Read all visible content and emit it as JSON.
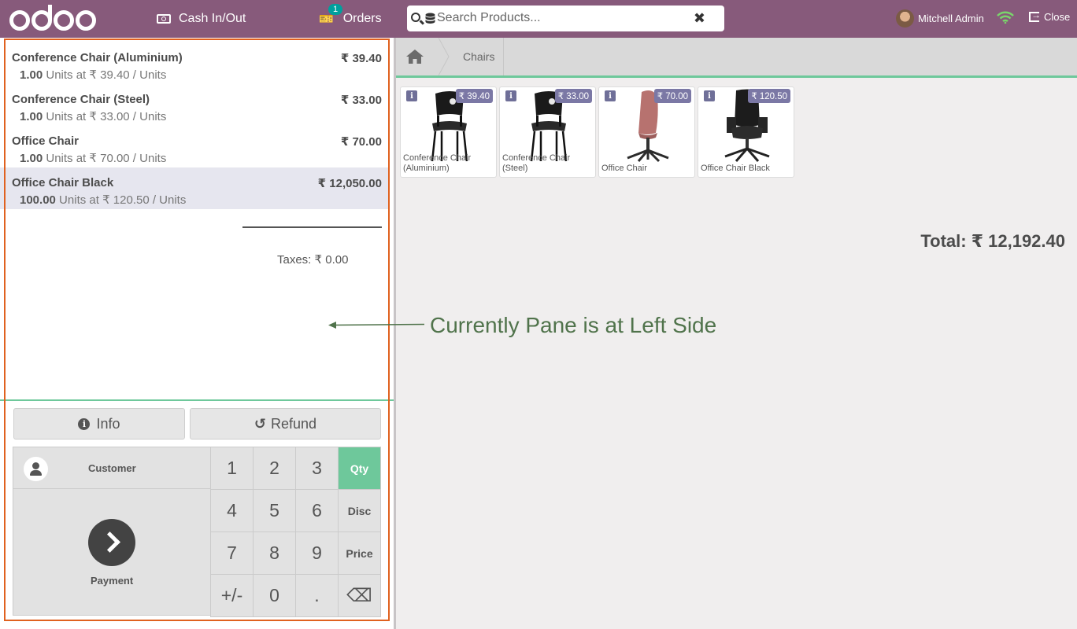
{
  "header": {
    "logo_text": "odoo",
    "cash_label": "Cash In/Out",
    "orders_label": "Orders",
    "orders_badge": "1",
    "search_placeholder": "Search Products...",
    "user_name": "Mitchell Admin",
    "close_label": "Close"
  },
  "order": {
    "lines": [
      {
        "name": "Conference Chair (Aluminium)",
        "price": "₹ 39.40",
        "qty": "1.00",
        "info": " Units at ₹ 39.40 / Units",
        "selected": false
      },
      {
        "name": "Conference Chair (Steel)",
        "price": "₹ 33.00",
        "qty": "1.00",
        "info": " Units at ₹ 33.00 / Units",
        "selected": false
      },
      {
        "name": "Office Chair",
        "price": "₹ 70.00",
        "qty": "1.00",
        "info": " Units at ₹ 70.00 / Units",
        "selected": false
      },
      {
        "name": "Office Chair Black",
        "price": "₹ 12,050.00",
        "qty": "100.00",
        "info": " Units at ₹ 120.50 / Units",
        "selected": true
      }
    ],
    "total": "Total: ₹ 12,192.40",
    "taxes": "Taxes: ₹ 0.00"
  },
  "actions": {
    "info_label": "Info",
    "refund_label": "Refund",
    "customer_label": "Customer",
    "payment_label": "Payment"
  },
  "numpad": {
    "keys": [
      "1",
      "2",
      "3",
      "Qty",
      "4",
      "5",
      "6",
      "Disc",
      "7",
      "8",
      "9",
      "Price",
      "+/-",
      "0",
      ".",
      "⌫"
    ],
    "active_mode": "Qty"
  },
  "breadcrumb": {
    "category": "Chairs"
  },
  "products": [
    {
      "name": "Conference Chair (Aluminium)",
      "price": "₹ 39.40",
      "image": "black-stacking-chair"
    },
    {
      "name": "Conference Chair (Steel)",
      "price": "₹ 33.00",
      "image": "black-stacking-chair"
    },
    {
      "name": "Office Chair",
      "price": "₹ 70.00",
      "image": "pink-swivel-chair"
    },
    {
      "name": "Office Chair Black",
      "price": "₹ 120.50",
      "image": "black-office-chair"
    }
  ],
  "annotation": {
    "text": "Currently Pane is at Left Side"
  },
  "colors": {
    "brand": "#875a7b",
    "accent_green": "#6ec89b",
    "annotation_orange": "#e0611f",
    "annotation_text": "#50734b"
  }
}
